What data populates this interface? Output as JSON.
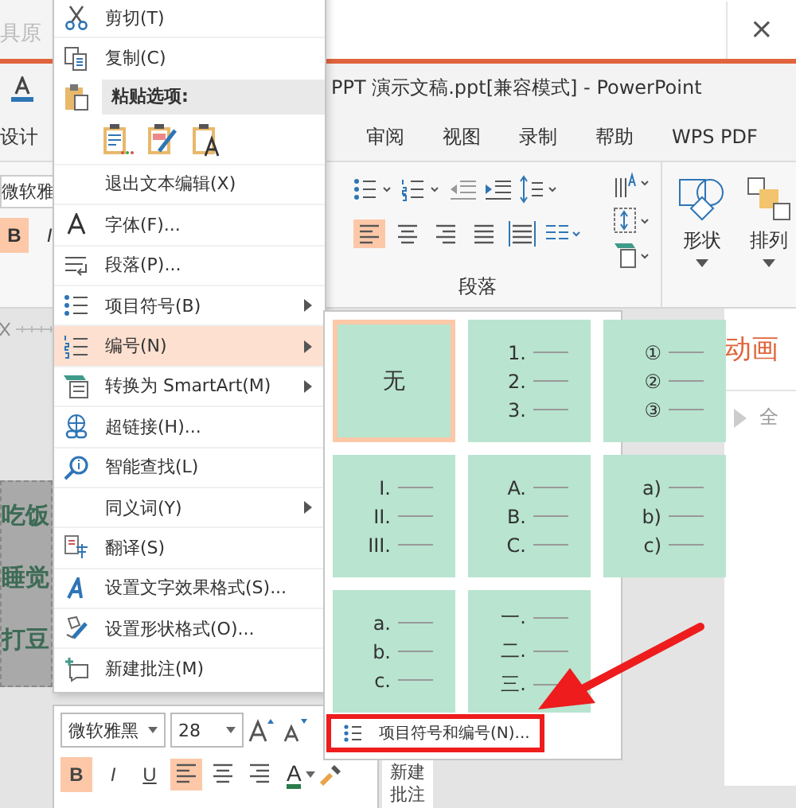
{
  "window": {
    "title": "PPT 演示文稿.ppt[兼容模式]  -  PowerPoint",
    "backdrop_text": "具原",
    "close": "×"
  },
  "ribbon_tabs": [
    {
      "label": "设计",
      "selected": false
    },
    {
      "label": "审阅",
      "selected": false
    },
    {
      "label": "视图",
      "selected": false
    },
    {
      "label": "录制",
      "selected": false
    },
    {
      "label": "帮助",
      "selected": false
    },
    {
      "label": "WPS PDF",
      "selected": false
    }
  ],
  "ribbon": {
    "font_name": "微软雅",
    "format_buttons": [
      {
        "label": "B",
        "selected": true
      },
      {
        "label": "I",
        "selected": false
      }
    ],
    "align_buttons": [
      {
        "kind": "left",
        "selected": true
      },
      {
        "kind": "center",
        "selected": false
      },
      {
        "kind": "right",
        "selected": false
      },
      {
        "kind": "justify",
        "selected": false
      },
      {
        "kind": "distributed",
        "selected": false
      }
    ],
    "group_label": "段落",
    "buttons": [
      "形状",
      "排列"
    ]
  },
  "slide": {
    "lines": [
      "吃饭",
      "睡觉",
      "打豆"
    ]
  },
  "side_pane": {
    "title": "动画",
    "play": "全"
  },
  "context_menu": [
    {
      "kind": "item",
      "label": "剪切(T)",
      "submenu": false,
      "selected": false
    },
    {
      "kind": "item",
      "label": "复制(C)",
      "submenu": false,
      "selected": false
    },
    {
      "kind": "header",
      "label": "粘贴选项:"
    },
    {
      "kind": "paste"
    },
    {
      "kind": "item",
      "label": "退出文本编辑(X)",
      "submenu": false,
      "selected": false
    },
    {
      "kind": "item",
      "label": "字体(F)...",
      "submenu": false,
      "selected": false
    },
    {
      "kind": "item",
      "label": "段落(P)...",
      "submenu": false,
      "selected": false
    },
    {
      "kind": "item",
      "label": "项目符号(B)",
      "submenu": true,
      "selected": false
    },
    {
      "kind": "item",
      "label": "编号(N)",
      "submenu": true,
      "selected": true
    },
    {
      "kind": "item",
      "label": "转换为 SmartArt(M)",
      "submenu": true,
      "selected": false
    },
    {
      "kind": "item",
      "label": "超链接(H)...",
      "submenu": false,
      "selected": false
    },
    {
      "kind": "item",
      "label": "智能查找(L)",
      "submenu": false,
      "selected": false
    },
    {
      "kind": "item",
      "label": "同义词(Y)",
      "submenu": true,
      "selected": false
    },
    {
      "kind": "item",
      "label": "翻译(S)",
      "submenu": false,
      "selected": false
    },
    {
      "kind": "item",
      "label": "设置文字效果格式(S)...",
      "submenu": false,
      "selected": false
    },
    {
      "kind": "item",
      "label": "设置形状格式(O)...",
      "submenu": false,
      "selected": false
    },
    {
      "kind": "item",
      "label": "新建批注(M)",
      "submenu": false,
      "selected": false
    }
  ],
  "numbering_gallery": {
    "tiles": [
      {
        "kind": "none",
        "label": "无",
        "selected": true
      },
      {
        "kind": "list",
        "markers": [
          "1.",
          "2.",
          "3."
        ],
        "selected": false
      },
      {
        "kind": "list",
        "markers": [
          "①",
          "②",
          "③"
        ],
        "selected": false
      },
      {
        "kind": "list",
        "markers": [
          "I.",
          "II.",
          "III."
        ],
        "selected": false
      },
      {
        "kind": "list",
        "markers": [
          "A.",
          "B.",
          "C."
        ],
        "selected": false
      },
      {
        "kind": "list",
        "markers": [
          "a)",
          "b)",
          "c)"
        ],
        "selected": false
      },
      {
        "kind": "list",
        "markers": [
          "a.",
          "b.",
          "c."
        ],
        "selected": false
      },
      {
        "kind": "list",
        "markers": [
          "一.",
          "二.",
          "三."
        ],
        "selected": false
      }
    ],
    "footer": "项目符号和编号(N)..."
  },
  "mini_toolbar": {
    "font": "微软雅黑",
    "size": "28",
    "format_buttons": [
      {
        "label": "B",
        "selected": true
      },
      {
        "label": "I",
        "selected": false
      },
      {
        "label": "U",
        "selected": false
      }
    ],
    "align_buttons": [
      {
        "kind": "left",
        "selected": true
      },
      {
        "kind": "center",
        "selected": false
      },
      {
        "kind": "right",
        "selected": false
      }
    ],
    "font_color_letter": "A",
    "new_comment": "新建批注"
  }
}
